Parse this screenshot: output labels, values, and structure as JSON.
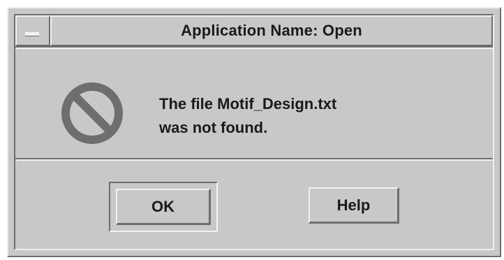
{
  "dialog": {
    "title": "Application Name: Open",
    "message_line1": "The file Motif_Design.txt",
    "message_line2": "was not found.",
    "icon": "error-no-entry-icon"
  },
  "buttons": {
    "ok_label": "OK",
    "help_label": "Help"
  },
  "colors": {
    "background": "#c8c8c8",
    "highlight": "#f2f2f2",
    "shadow": "#6e6e6e",
    "icon": "#6e6e6e",
    "text": "#1a1a1a"
  }
}
